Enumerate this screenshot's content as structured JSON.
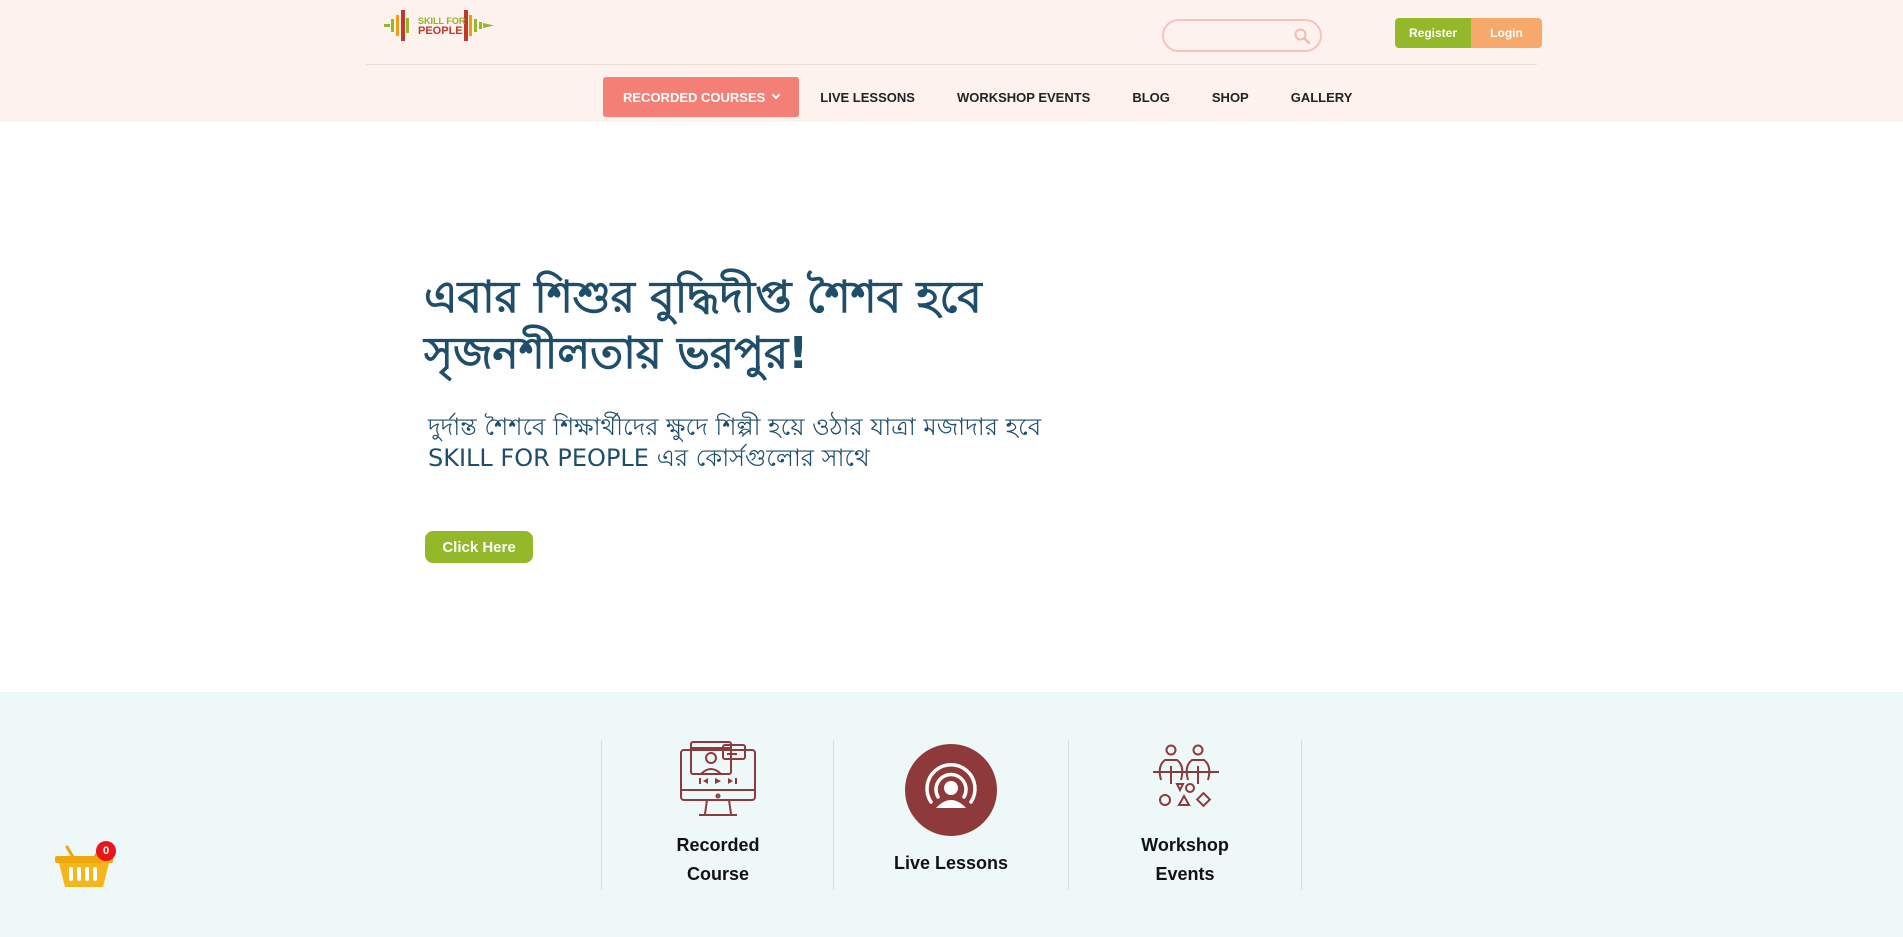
{
  "brand": {
    "line1": "SKILL FOR",
    "line2": "PEOPLE",
    "colors": {
      "green": "#93b829",
      "red": "#c0392b",
      "orange": "#f7a86b"
    }
  },
  "search": {
    "placeholder": "",
    "icon": "search-icon"
  },
  "auth": {
    "register": "Register",
    "login": "Login"
  },
  "nav": {
    "items": [
      {
        "label": "RECORDED COURSES",
        "active": true
      },
      {
        "label": "LIVE LESSONS"
      },
      {
        "label": "WORKSHOP EVENTS"
      },
      {
        "label": "BLOG"
      },
      {
        "label": "SHOP"
      },
      {
        "label": "GALLERY"
      }
    ]
  },
  "hero": {
    "title": "এবার শিশুর বুদ্ধিদীপ্ত শৈশব হবে সৃজনশীলতায় ভরপুর!",
    "subtitle": "দুর্দান্ত শৈশবে শিক্ষার্থীদের ক্ষুদে শিল্পী হয়ে ওঠার যাত্রা মজাদার হবে SKILL FOR PEOPLE এর কোর্সগুলোর সাথে",
    "cta": "Click Here"
  },
  "features": [
    {
      "label": "Recorded Course",
      "icon": "monitor-video-icon"
    },
    {
      "label": "Live Lessons",
      "icon": "broadcast-user-icon"
    },
    {
      "label": "Workshop Events",
      "icon": "people-shapes-icon"
    }
  ],
  "cart": {
    "count": "0",
    "icon": "basket-icon"
  }
}
